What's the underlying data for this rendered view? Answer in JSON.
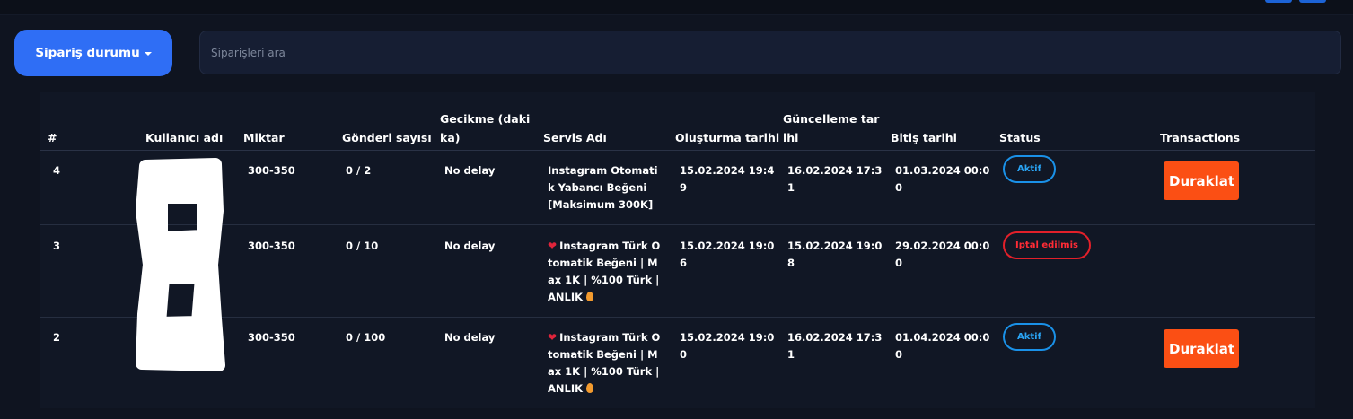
{
  "filter": {
    "status_button_label": "Sipariş durumu",
    "search_placeholder": "Siparişleri ara"
  },
  "table": {
    "headers": {
      "id": "#",
      "username": "Kullanıcı adı",
      "quantity": "Miktar",
      "sent_count": "Gönderi sayısı",
      "delay": "Gecikme (dakika)",
      "service_name": "Servis Adı",
      "created_at": "Oluşturma tarihi",
      "updated_at": "Güncelleme tarihi",
      "end_date": "Bitiş tarihi",
      "status": "Status",
      "transactions": "Transactions"
    },
    "rows": [
      {
        "id": "4",
        "quantity": "300-350",
        "sent_count": "0 / 2",
        "delay": "No delay",
        "service_name": "Instagram Otomatik Yabancı Beğeni [Maksimum 300K]",
        "created_at": "15.02.2024 19:49",
        "updated_at": "16.02.2024 17:31",
        "end_date": "01.03.2024 00:00",
        "status": "Aktif",
        "action": "Duraklat"
      },
      {
        "id": "3",
        "quantity": "300-350",
        "sent_count": "0 / 10",
        "delay": "No delay",
        "service_name": "Instagram Türk Otomatik Beğeni | Max 1K | %100 Türk | ANLIK",
        "created_at": "15.02.2024 19:06",
        "updated_at": "15.02.2024 19:08",
        "end_date": "29.02.2024 00:00",
        "status": "İptal edilmiş",
        "action": ""
      },
      {
        "id": "2",
        "quantity": "300-350",
        "sent_count": "0 / 100",
        "delay": "No delay",
        "service_name": "Instagram Türk Otomatik Beğeni | Max 1K | %100 Türk | ANLIK",
        "created_at": "15.02.2024 19:00",
        "updated_at": "16.02.2024 17:31",
        "end_date": "01.04.2024 00:00",
        "status": "Aktif",
        "action": "Duraklat"
      }
    ]
  },
  "icons": {
    "dropdown": "caret-down-icon",
    "service_prefix": "red-heart-icon",
    "service_suffix": "fire-icon"
  },
  "colors": {
    "page_bg": "#0f1420",
    "primary_button": "#2f6ef5",
    "search_bg": "#161e33",
    "active_badge": "#1a91e8",
    "cancelled_badge": "#e2202a",
    "pause_button": "#fb4f14"
  }
}
